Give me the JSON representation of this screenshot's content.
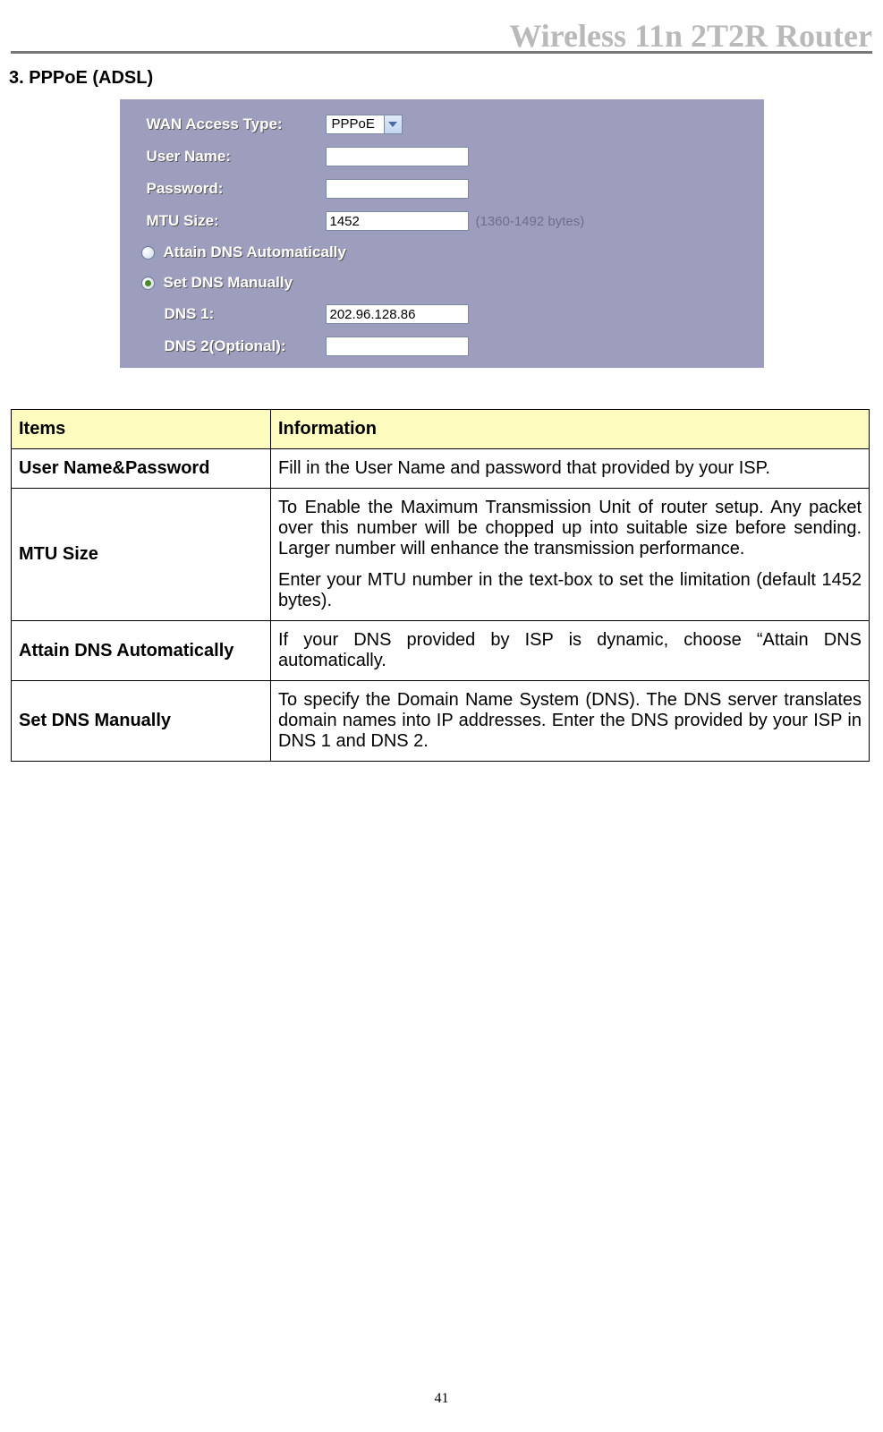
{
  "header": {
    "title": "Wireless 11n 2T2R Router"
  },
  "section": {
    "title": "3. PPPoE (ADSL)"
  },
  "panel": {
    "wan_access_type_label": "WAN Access Type:",
    "wan_access_type_value": "PPPoE",
    "user_name_label": "User Name:",
    "user_name_value": "",
    "password_label": "Password:",
    "password_value": "",
    "mtu_label": "MTU Size:",
    "mtu_value": "1452",
    "mtu_hint": "(1360-1492 bytes)",
    "dns_auto_label": "Attain DNS Automatically",
    "dns_manual_label": "Set DNS Manually",
    "dns1_label": "DNS 1:",
    "dns1_value": "202.96.128.86",
    "dns2_label": "DNS 2(Optional):",
    "dns2_value": ""
  },
  "table": {
    "header_items": "Items",
    "header_info": "Information",
    "rows": [
      {
        "item": "User Name&Password",
        "info": [
          "Fill in the User Name and password that provided by your ISP."
        ]
      },
      {
        "item": "MTU Size",
        "info": [
          "To Enable the Maximum Transmission Unit of router setup. Any packet over this number will be chopped up into suitable size before sending. Larger number will enhance the transmission performance.",
          "Enter your MTU number in the text-box to set the limitation (default 1452 bytes)."
        ]
      },
      {
        "item": "Attain DNS Automatically",
        "info": [
          "If your DNS provided by ISP is dynamic, choose “Attain DNS automatically."
        ]
      },
      {
        "item": "Set DNS Manually",
        "info": [
          "To specify the Domain Name System (DNS). The DNS server translates domain names into IP addresses. Enter the DNS provided by your ISP in DNS 1 and DNS 2."
        ]
      }
    ]
  },
  "page_number": "41"
}
